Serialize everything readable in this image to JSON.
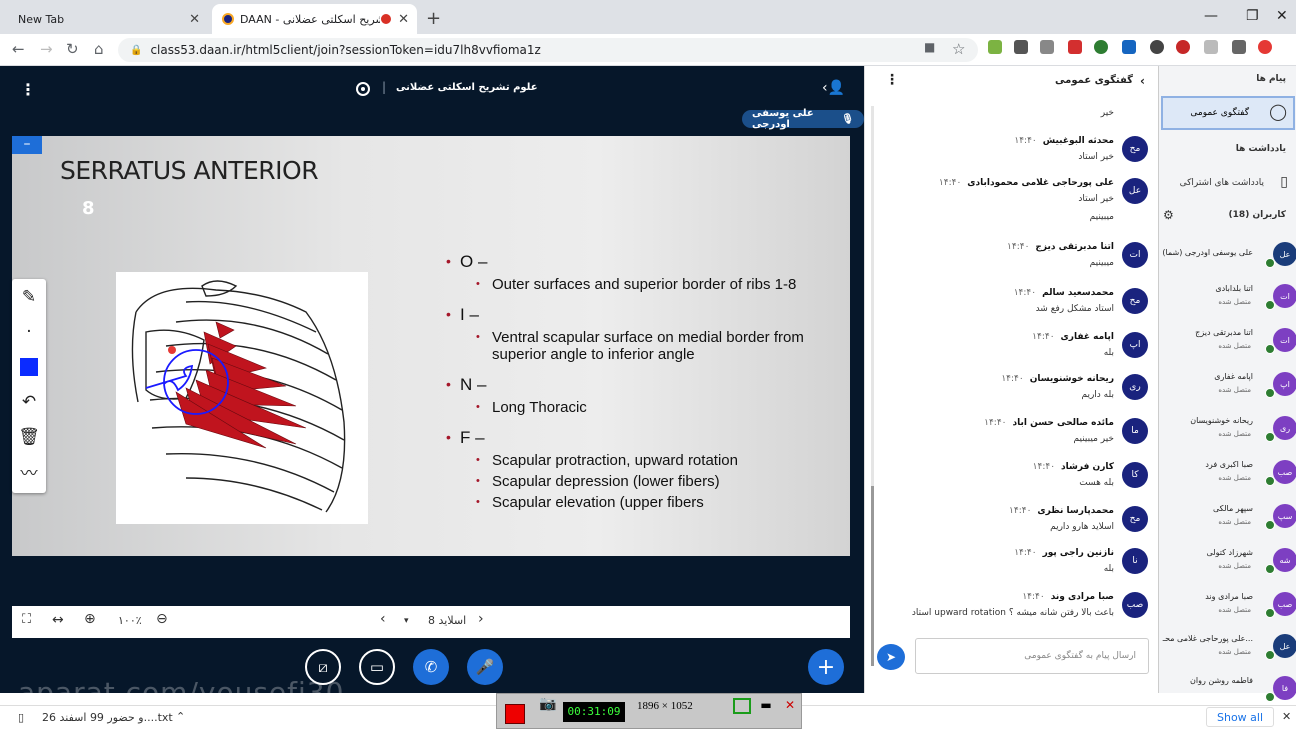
{
  "browser": {
    "tabs": [
      {
        "label": "New Tab"
      },
      {
        "label": "DAAN - علوم تشریح اسکلتی عضلانی"
      }
    ],
    "url": "class53.daan.ir/html5client/join?sessionToken=idu7lh8vvfioma1z"
  },
  "meeting": {
    "title": "علوم تشریح اسکلتی عضلانی",
    "presenter": "علی یوسفی اودرجی",
    "slide": {
      "title": "SERRATUS ANTERIOR",
      "number": "8",
      "bullets": [
        {
          "head": "O –",
          "items": [
            "Outer surfaces and superior border of ribs 1-8"
          ]
        },
        {
          "head": "I –",
          "items": [
            "Ventral scapular surface on medial border from superior angle to inferior angle"
          ]
        },
        {
          "head": "N –",
          "items": [
            "Long Thoracic"
          ]
        },
        {
          "head": "F –",
          "items": [
            "Scapular protraction, upward rotation",
            "Scapular depression (lower fibers)",
            "Scapular elevation (upper fibers"
          ]
        }
      ]
    },
    "slidebar": {
      "zoom": "۱۰۰٪",
      "slide_label": "اسلاید 8"
    },
    "watermark": "aparat.com/yousefi30"
  },
  "chat": {
    "title": "گفتگوی عمومی",
    "input_placeholder": "ارسال پیام به گفتگوی عمومی",
    "messages": [
      {
        "name": "",
        "time": "",
        "text": "خیر",
        "initials": ""
      },
      {
        "name": "محدثه البوغبیش",
        "time": "۱۴:۴۰",
        "text": "خیر استاد",
        "initials": "مح"
      },
      {
        "name": "علی پورحاجی غلامی محمودابادی",
        "time": "۱۴:۴۰",
        "text": "خیر استاد",
        "text2": "میبینیم",
        "initials": "عل"
      },
      {
        "name": "اتنا مدبرتقی دیزج",
        "time": "۱۴:۴۰",
        "text": "میبینیم",
        "initials": "ات"
      },
      {
        "name": "محمدسعید سالم",
        "time": "۱۴:۴۰",
        "text": "استاد مشکل رفع شد",
        "initials": "مح"
      },
      {
        "name": "اپامه غفاری",
        "time": "۱۴:۴۰",
        "text": "بله",
        "initials": "اپ"
      },
      {
        "name": "ریحانه خوشنویسان",
        "time": "۱۴:۴۰",
        "text": "بله داریم",
        "initials": "ری"
      },
      {
        "name": "مائده صالحی حسن اباد",
        "time": "۱۴:۴۰",
        "text": "خیر میبینیم",
        "initials": "ما"
      },
      {
        "name": "کارن فرشاد",
        "time": "۱۴:۴۰",
        "text": "بله هست",
        "initials": "کا"
      },
      {
        "name": "محمدپارسا نظری",
        "time": "۱۴:۴۰",
        "text": "اسلاید هارو داریم",
        "initials": "مح"
      },
      {
        "name": "نازنین راجی پور",
        "time": "۱۴:۴۰",
        "text": "بله",
        "initials": "نا"
      },
      {
        "name": "صبا مرادی وند",
        "time": "۱۴:۴۰",
        "text": "استاد upward rotation باعث بالا رفتن شانه میشه ؟",
        "initials": "صب"
      }
    ]
  },
  "users": {
    "header": "پیام ها",
    "public_chat": "گفتگوی عمومی",
    "notes_header": "یادداشت ها",
    "shared_notes": "یادداشت های اشتراکی",
    "users_header": "کاربران (18)",
    "status": "متصل شده",
    "list": [
      {
        "name": "علی یوسفی اودرجی (شما)",
        "initials": "عل"
      },
      {
        "name": "اتنا بلدابادی",
        "initials": "ات"
      },
      {
        "name": "اتنا مدبرتقی دیزج",
        "initials": "ات"
      },
      {
        "name": "اپامه غفاری",
        "initials": "اپ"
      },
      {
        "name": "ریحانه خوشنویسان",
        "initials": "ری"
      },
      {
        "name": "صبا اکبری فرد",
        "initials": "صب"
      },
      {
        "name": "سپهر مالکی",
        "initials": "سپ"
      },
      {
        "name": "شهرزاد کتولی",
        "initials": "شه"
      },
      {
        "name": "صبا مرادی وند",
        "initials": "صب"
      },
      {
        "name": "علی پورحاجی غلامی محـ...",
        "initials": "عل"
      },
      {
        "name": "فاطمه روشن روان",
        "initials": "فا"
      }
    ]
  },
  "downloads": {
    "file": "26 و حضور 99 اسفند....txt",
    "show_all": "Show all"
  },
  "recorder": {
    "time": "00:31:09",
    "size": "1896 × 1052"
  },
  "colors": {
    "accent": "#1e6ed8",
    "meeting_bg": "#06172a",
    "muscle": "#c0141e"
  }
}
